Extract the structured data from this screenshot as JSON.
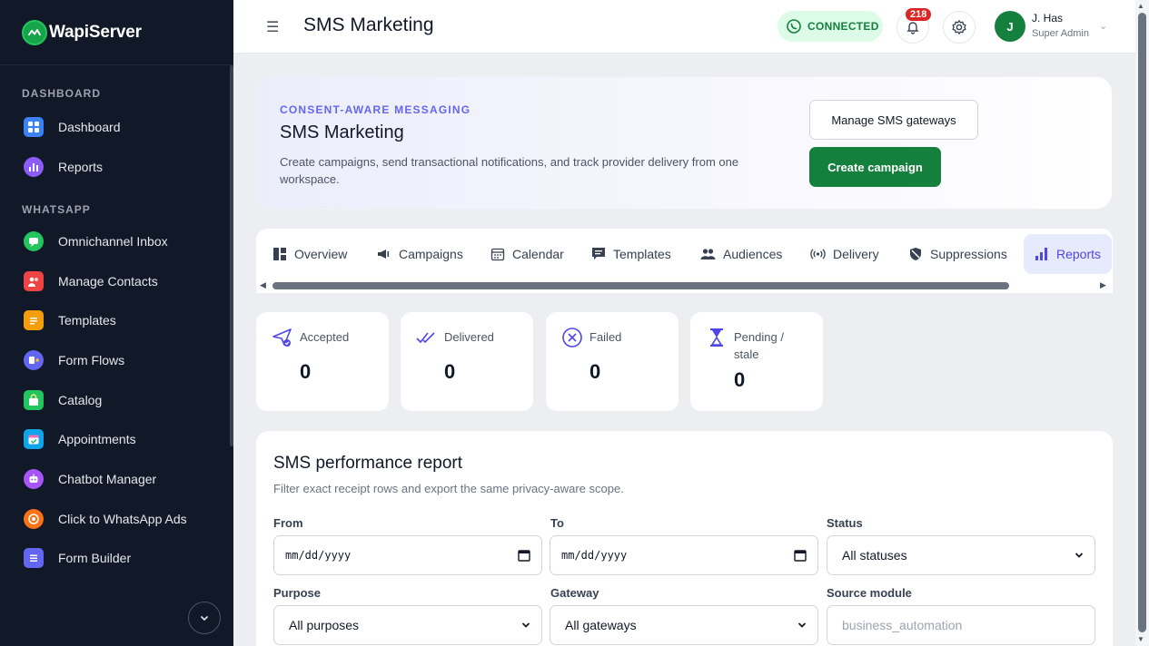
{
  "brand": {
    "name": "WapiServer"
  },
  "sidebar": {
    "sections": [
      {
        "title": "DASHBOARD",
        "items": [
          {
            "label": "Dashboard",
            "icon": "dashboard-icon",
            "color": "#3b82f6"
          },
          {
            "label": "Reports",
            "icon": "reports-icon",
            "color": "#8b5cf6"
          }
        ]
      },
      {
        "title": "WHATSAPP",
        "items": [
          {
            "label": "Omnichannel Inbox",
            "icon": "inbox-icon",
            "color": "#22c55e"
          },
          {
            "label": "Manage Contacts",
            "icon": "contacts-icon",
            "color": "#ef4444"
          },
          {
            "label": "Templates",
            "icon": "templates-icon",
            "color": "#f59e0b"
          },
          {
            "label": "Form Flows",
            "icon": "form-flows-icon",
            "color": "#6366f1"
          },
          {
            "label": "Catalog",
            "icon": "catalog-icon",
            "color": "#22c55e"
          },
          {
            "label": "Appointments",
            "icon": "appointments-icon",
            "color": "#0ea5e9"
          },
          {
            "label": "Chatbot Manager",
            "icon": "chatbot-icon",
            "color": "#a855f7"
          },
          {
            "label": "Click to WhatsApp Ads",
            "icon": "ads-icon",
            "color": "#f97316"
          },
          {
            "label": "Form Builder",
            "icon": "form-builder-icon",
            "color": "#6366f1"
          }
        ]
      }
    ]
  },
  "header": {
    "title": "SMS Marketing",
    "connection_status": "CONNECTED",
    "notification_count": "218",
    "user": {
      "initial": "J",
      "name": "J. Has",
      "role": "Super Admin"
    }
  },
  "hero": {
    "eyebrow": "CONSENT-AWARE MESSAGING",
    "title": "SMS Marketing",
    "description": "Create campaigns, send transactional notifications, and track provider delivery from one workspace.",
    "manage_gateways_label": "Manage SMS gateways",
    "create_campaign_label": "Create campaign"
  },
  "tabs": [
    {
      "label": "Overview",
      "icon": "overview-icon"
    },
    {
      "label": "Campaigns",
      "icon": "megaphone-icon"
    },
    {
      "label": "Calendar",
      "icon": "calendar-icon"
    },
    {
      "label": "Templates",
      "icon": "template-icon"
    },
    {
      "label": "Audiences",
      "icon": "audiences-icon"
    },
    {
      "label": "Delivery",
      "icon": "broadcast-icon"
    },
    {
      "label": "Suppressions",
      "icon": "shield-icon"
    },
    {
      "label": "Reports",
      "icon": "bar-chart-icon",
      "active": true
    }
  ],
  "stats": [
    {
      "label": "Accepted",
      "value": "0",
      "icon": "send-check-icon"
    },
    {
      "label": "Delivered",
      "value": "0",
      "icon": "double-check-icon"
    },
    {
      "label": "Failed",
      "value": "0",
      "icon": "x-circle-icon"
    },
    {
      "label": "Pending / stale",
      "value": "0",
      "icon": "hourglass-icon"
    }
  ],
  "report": {
    "title": "SMS performance report",
    "subtitle": "Filter exact receipt rows and export the same privacy-aware scope.",
    "filters": {
      "from": {
        "label": "From",
        "value": "mm/dd/yyyy"
      },
      "to": {
        "label": "To",
        "value": "mm/dd/yyyy"
      },
      "status": {
        "label": "Status",
        "value": "All statuses"
      },
      "purpose": {
        "label": "Purpose",
        "value": "All purposes"
      },
      "gateway": {
        "label": "Gateway",
        "value": "All gateways"
      },
      "source_module": {
        "label": "Source module",
        "placeholder": "business_automation"
      }
    }
  },
  "colors": {
    "accent": "#4f46e5",
    "primary": "#15803d",
    "sidebar_bg": "#111827"
  }
}
